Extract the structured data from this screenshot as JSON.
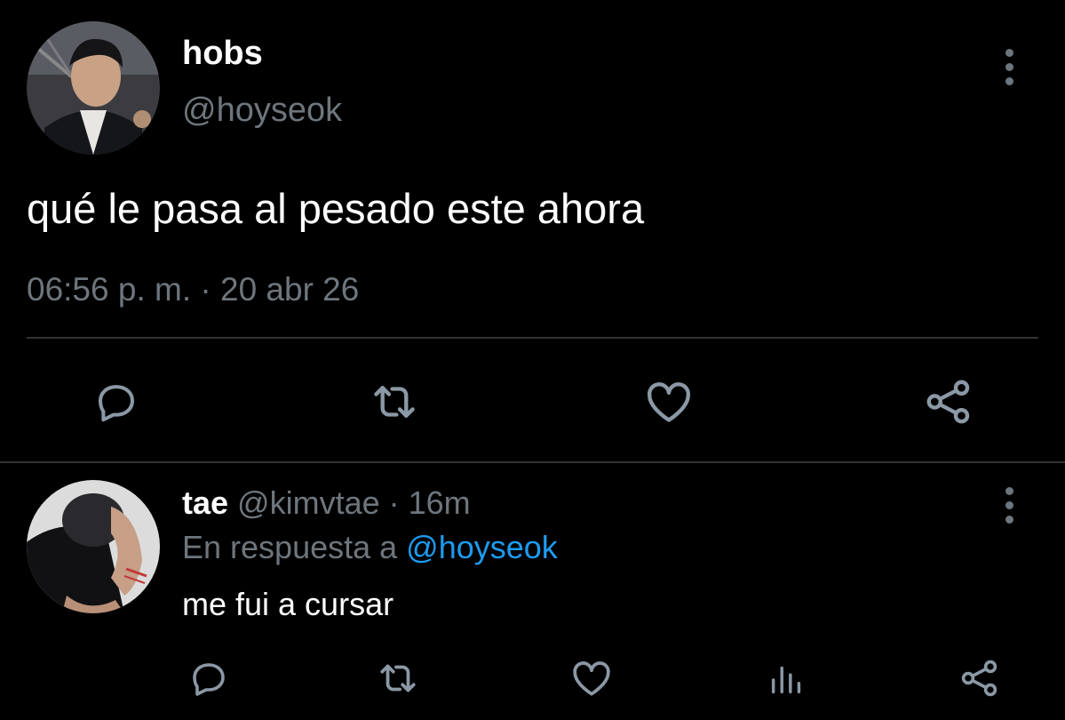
{
  "main_tweet": {
    "display_name": "hobs",
    "handle": "@hoyseok",
    "text": "qué le pasa al pesado este ahora",
    "timestamp": "06:56 p. m. · 20 abr 26",
    "actions": [
      "reply-icon",
      "retweet-icon",
      "like-icon",
      "share-icon"
    ]
  },
  "reply": {
    "display_name": "tae",
    "handle": "@kimvtae",
    "separator": " · ",
    "time_ago": "16m",
    "context_prefix": "En respuesta a ",
    "context_mention": "@hoyseok",
    "text": "me fui a cursar",
    "actions": [
      "reply-icon",
      "retweet-icon",
      "like-icon",
      "stats-icon",
      "share-icon"
    ]
  },
  "colors": {
    "background": "#000000",
    "primary_text": "#ffffff",
    "secondary_text": "#6e767d",
    "link": "#1d9bf0",
    "divider": "#2f3336"
  }
}
